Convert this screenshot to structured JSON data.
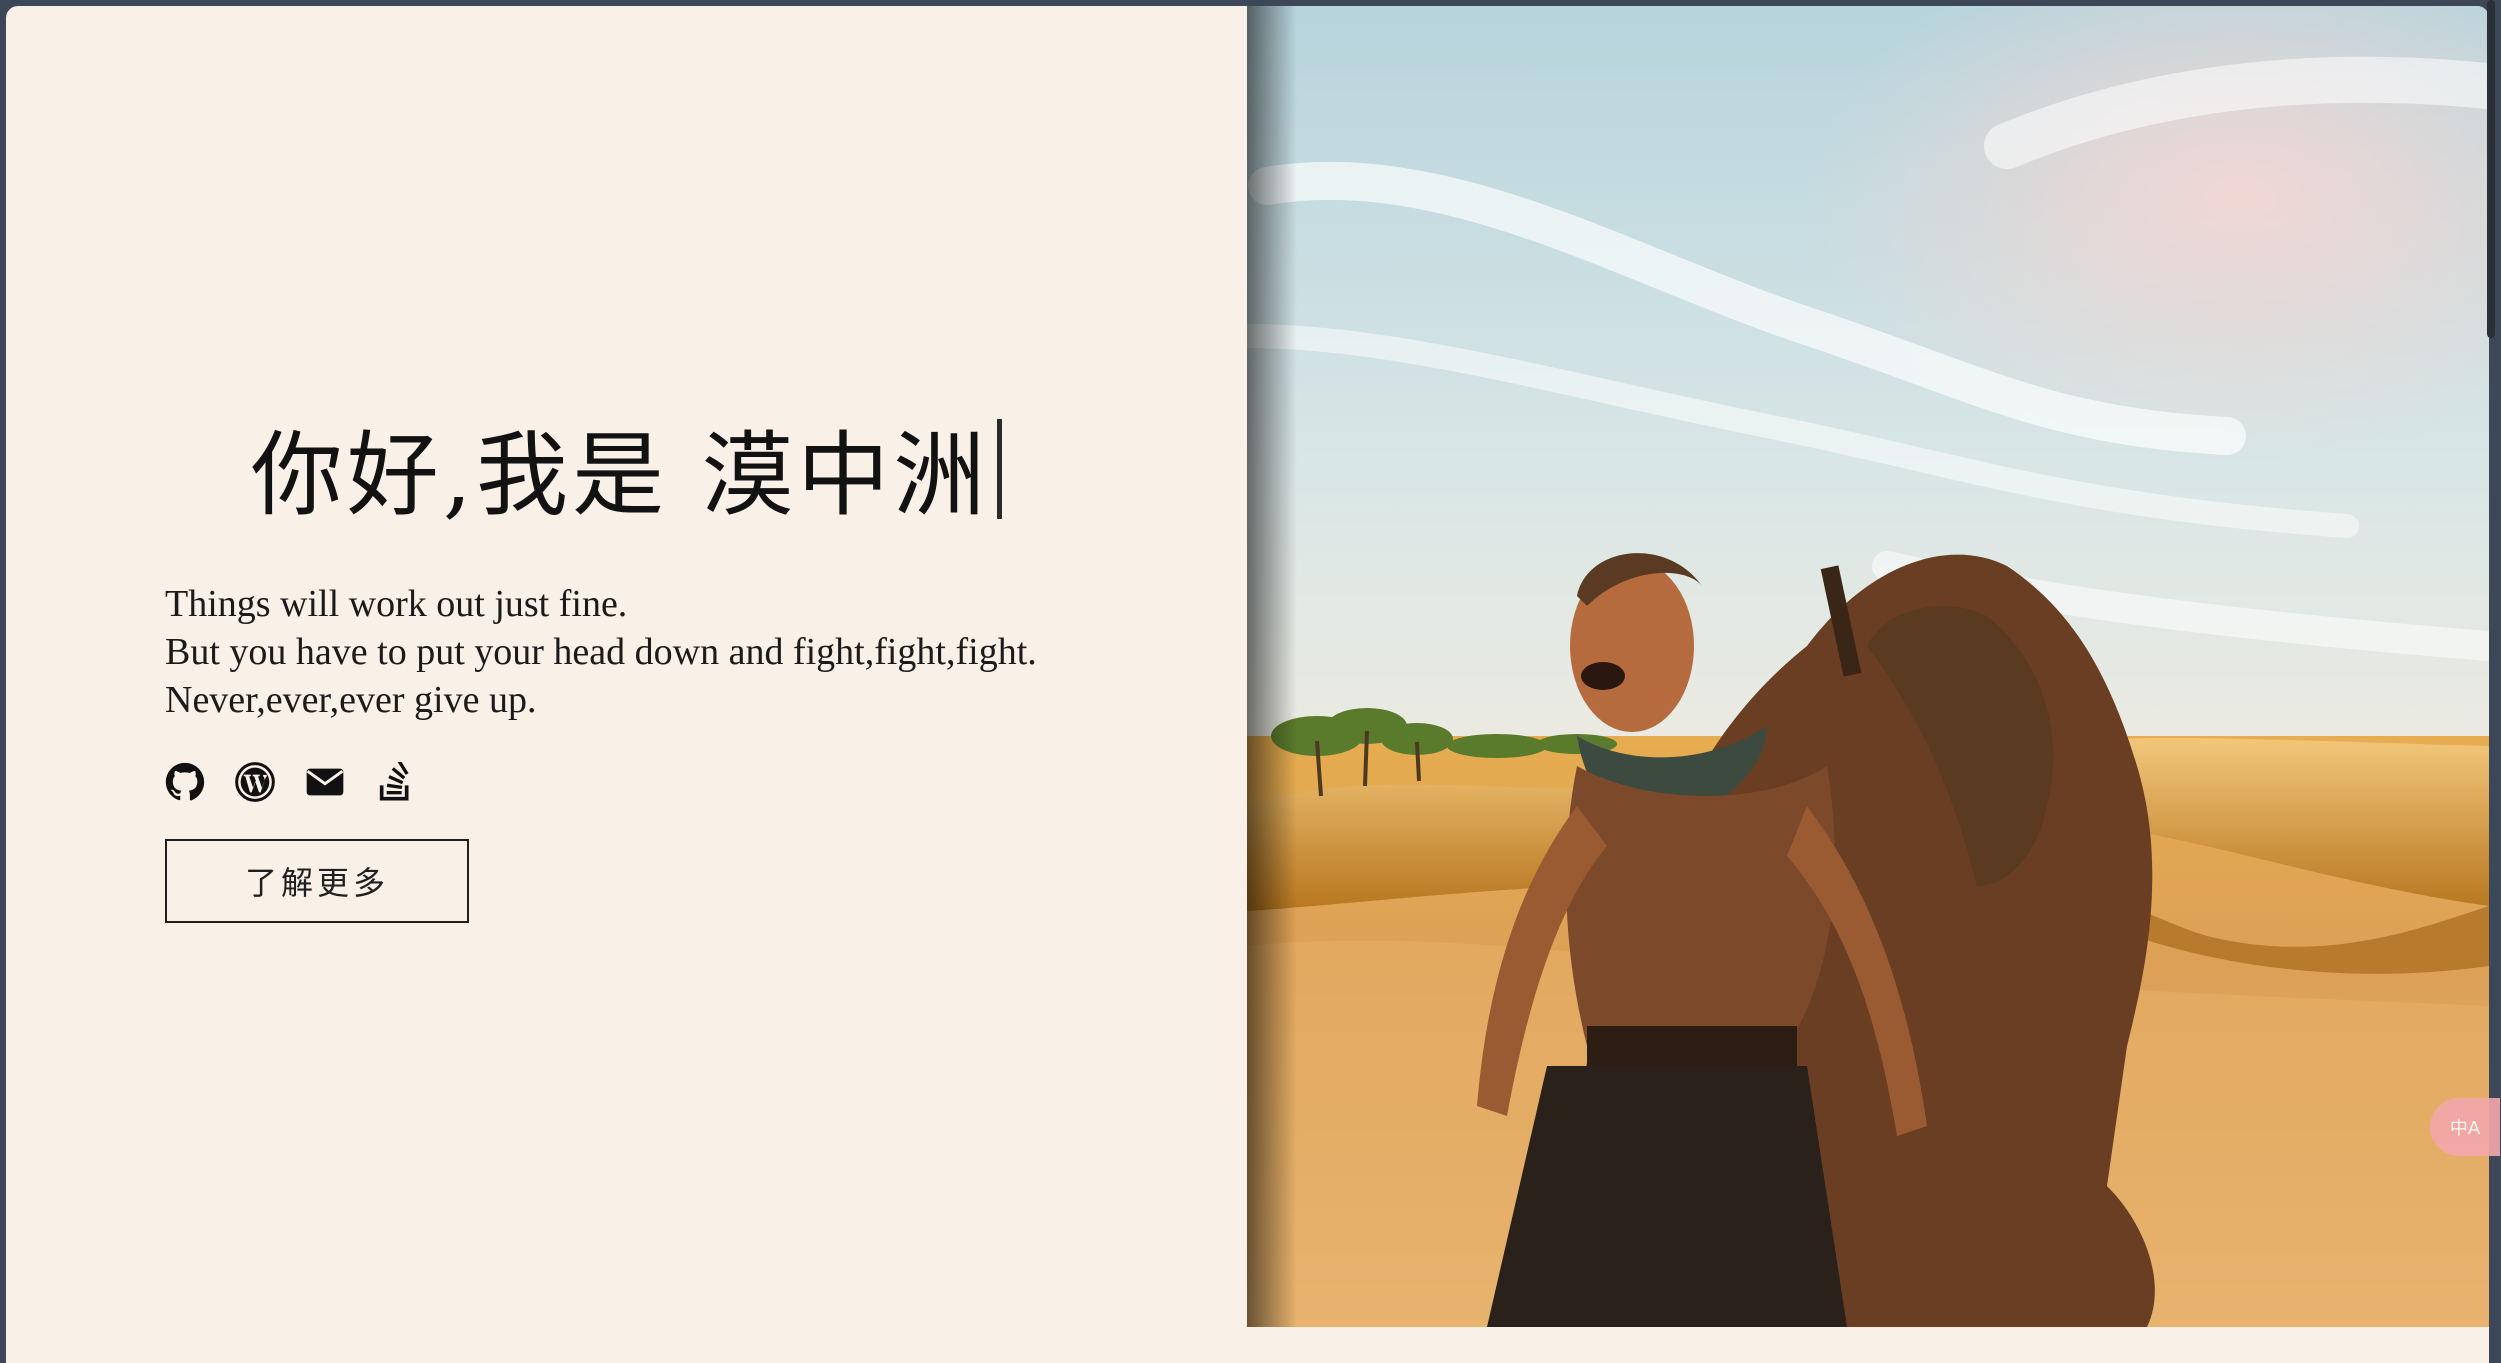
{
  "hero": {
    "greeting": "你好,我是 漠中洲",
    "tagline": [
      "Things will work out just fine.",
      "But you have to put your head down and fight,fight,fight.",
      "Never,ever,ever give up."
    ],
    "learn_more_label": "了解更多"
  },
  "socials": [
    {
      "icon": "github-icon"
    },
    {
      "icon": "wordpress-icon"
    },
    {
      "icon": "email-icon"
    },
    {
      "icon": "stack-overflow-icon"
    }
  ],
  "translate_widget": {
    "label": "中A"
  },
  "colors": {
    "page_background": "#f9f0e8",
    "window_background": "#3c4758",
    "text": "#121212"
  }
}
